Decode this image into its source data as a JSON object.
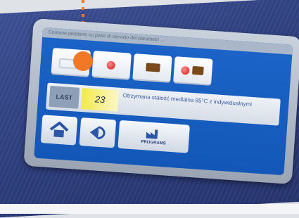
{
  "screen": {
    "title_text": "Comune pieptene cu paso di servizio dei parametri ..."
  },
  "status_row": {
    "last_label": "LAST",
    "counter_value": "23",
    "description": "Otrzymana stałość medialna 85°C z indywidualnymi"
  },
  "nav": {
    "program_label": "PROGRAMS"
  },
  "colors": {
    "panel": "#2f4286",
    "screen": "#1c64c8",
    "accent": "#f07826"
  }
}
